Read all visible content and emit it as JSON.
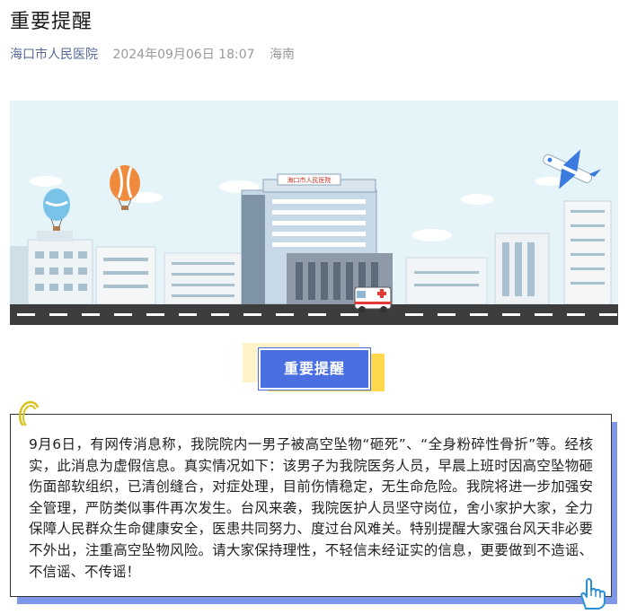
{
  "article": {
    "title": "重要提醒",
    "source": "海口市人民医院",
    "datetime": "2024年09月06日 18:07",
    "location": "海南"
  },
  "banner": {
    "hospital_sign": "海口市人民医院"
  },
  "badge": {
    "label": "重要提醒"
  },
  "body": {
    "text": "9月6日，有网传消息称，我院院内一男子被高空坠物“砸死”、“全身粉碎性骨折”等。经核实，此消息为虚假信息。真实情况如下：该男子为我院医务人员，早晨上班时因高空坠物砸伤面部软组织，已清创缝合，对症处理，目前伤情稳定，无生命危险。我院将进一步加强安全管理，严防类似事件再次发生。台风来袭，我院医护人员坚守岗位，舍小家护大家，全力保障人民群众生命健康安全，医患共同努力、度过台风难关。特别提醒大家强台风天非必要不外出，注重高空坠物风险。请大家保持理性，不轻信未经证实的信息，更要做到不造谣、不信谣、不传谣！"
  },
  "colors": {
    "accent": "#4a6fe0",
    "source_link": "#576b95",
    "sky": "#e4f4f9",
    "highlight": "#ffd84d"
  }
}
